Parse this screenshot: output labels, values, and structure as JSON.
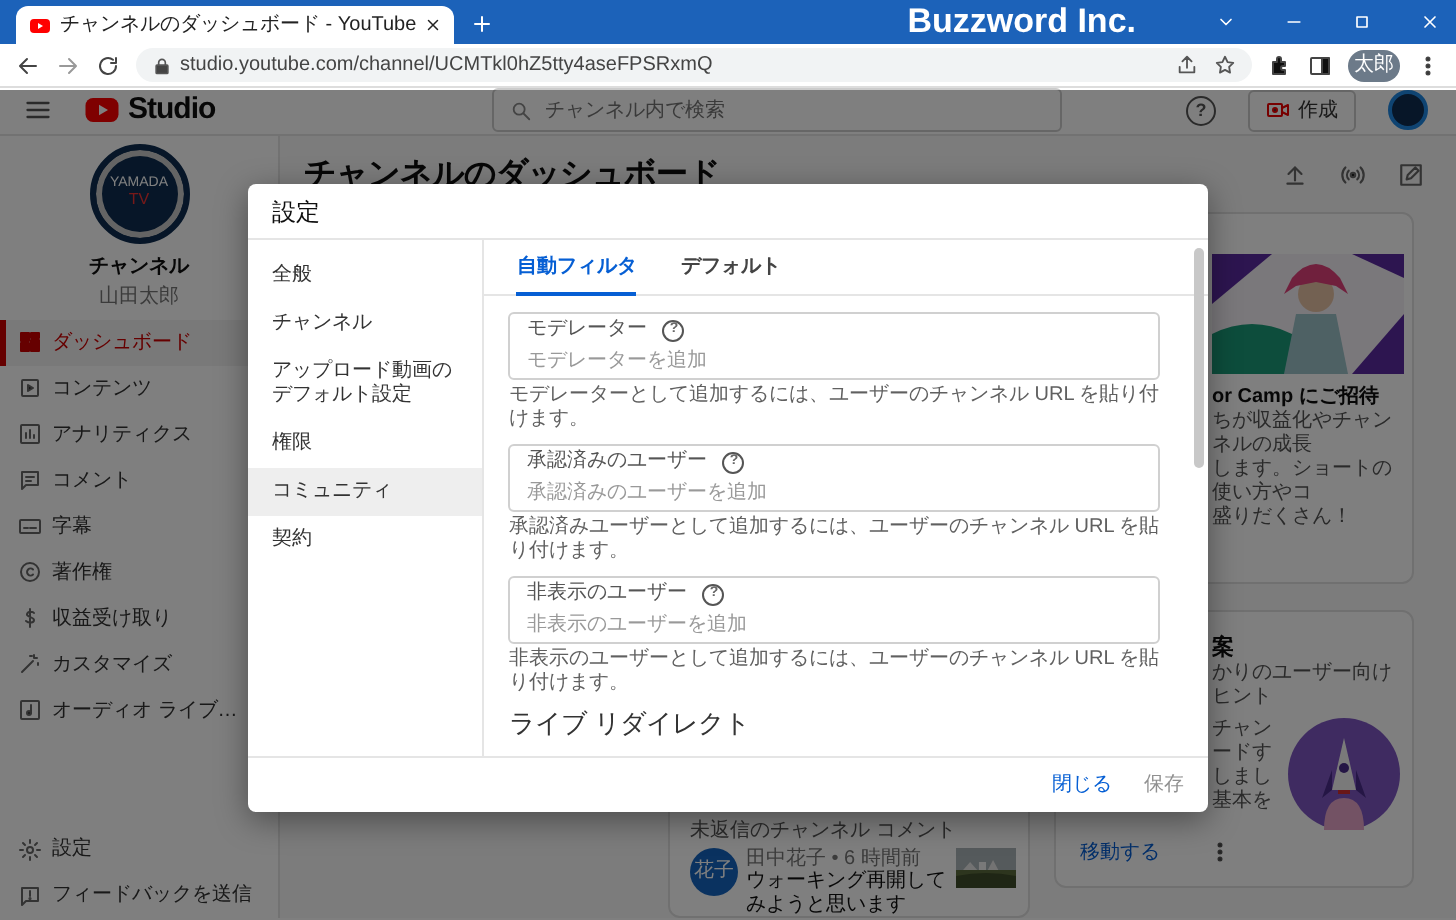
{
  "browser": {
    "tab_title": "チャンネルのダッシュボード - YouTube",
    "brand": "Buzzword Inc.",
    "url": "studio.youtube.com/channel/UCMTkl0hZ5tty4aseFPSRxmQ",
    "profile": "太郎"
  },
  "header": {
    "logo": "Studio",
    "search_placeholder": "チャンネル内で検索",
    "help_mark": "?",
    "create_button": "作成"
  },
  "sidebar": {
    "logo_top": "YAMADA",
    "logo_bottom": "TV",
    "channel_label": "チャンネル",
    "channel_name": "山田太郎",
    "items": [
      {
        "label": "ダッシュボード",
        "selected": true
      },
      {
        "label": "コンテンツ",
        "selected": false
      },
      {
        "label": "アナリティクス",
        "selected": false
      },
      {
        "label": "コメント",
        "selected": false
      },
      {
        "label": "字幕",
        "selected": false
      },
      {
        "label": "著作権",
        "selected": false
      },
      {
        "label": "収益受け取り",
        "selected": false
      },
      {
        "label": "カスタマイズ",
        "selected": false
      },
      {
        "label": "オーディオ ライブ…",
        "selected": false
      }
    ],
    "bottom_items": [
      {
        "label": "設定"
      },
      {
        "label": "フィードバックを送信"
      }
    ]
  },
  "dashboard": {
    "title": "チャンネルのダッシュボード",
    "comment_card": {
      "title": "未返信のチャンネル コメント",
      "avatar": "花子",
      "meta": "田中花子 • 6 時間前",
      "text": "ウォーキング再開してみようと思います"
    },
    "promo_card": {
      "title": "or Camp にご招待",
      "lines": [
        "ちが収益化やチャンネルの成長",
        "します。ショートの使い方やコ",
        "盛りだくさん！"
      ]
    },
    "tips_card": {
      "title": "案",
      "subtitle": "かりのユーザー向けヒント",
      "lines": [
        "チャン",
        "ードす",
        "しまし",
        "基本を"
      ],
      "link": "移動する"
    }
  },
  "modal": {
    "title": "設定",
    "nav": [
      {
        "label": "全般",
        "selected": false
      },
      {
        "label": "チャンネル",
        "selected": false
      },
      {
        "label": "アップロード動画のデフォルト設定",
        "selected": false
      },
      {
        "label": "権限",
        "selected": false
      },
      {
        "label": "コミュニティ",
        "selected": true
      },
      {
        "label": "契約",
        "selected": false
      }
    ],
    "tabs": [
      {
        "label": "自動フィルタ",
        "selected": true
      },
      {
        "label": "デフォルト",
        "selected": false
      }
    ],
    "help_mark": "?",
    "fields": [
      {
        "label": "モデレーター",
        "placeholder": "モデレーターを追加",
        "help": "モデレーターとして追加するには、ユーザーのチャンネル URL を貼り付けます。"
      },
      {
        "label": "承認済みのユーザー",
        "placeholder": "承認済みのユーザーを追加",
        "help": "承認済みユーザーとして追加するには、ユーザーのチャンネル URL を貼り付けます。"
      },
      {
        "label": "非表示のユーザー",
        "placeholder": "非表示のユーザーを追加",
        "help": "非表示のユーザーとして追加するには、ユーザーのチャンネル URL を貼り付けます。"
      }
    ],
    "next_section": "ライブ リダイレクト",
    "buttons": [
      {
        "label": "閉じる",
        "disabled": false
      },
      {
        "label": "保存",
        "disabled": true
      }
    ]
  }
}
